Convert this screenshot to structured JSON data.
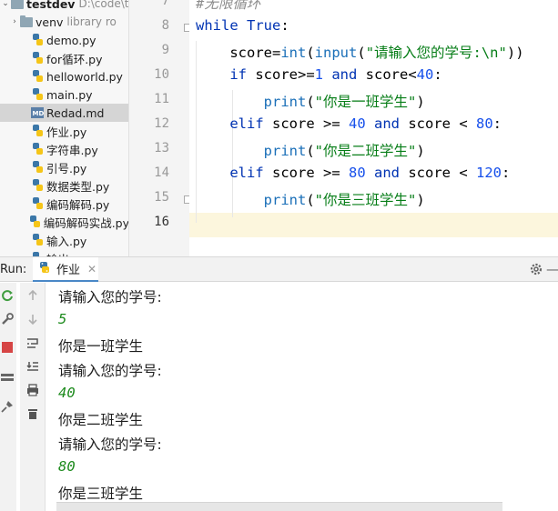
{
  "project": {
    "root": {
      "name": "testdev",
      "path": "D:\\code\\t"
    },
    "items": [
      {
        "type": "folder",
        "name": "venv",
        "note": "library ro"
      },
      {
        "type": "py",
        "name": "demo.py"
      },
      {
        "type": "py",
        "name": "for循环.py"
      },
      {
        "type": "py",
        "name": "helloworld.py"
      },
      {
        "type": "py",
        "name": "main.py"
      },
      {
        "type": "md",
        "name": "Redad.md",
        "selected": true
      },
      {
        "type": "py",
        "name": "作业.py"
      },
      {
        "type": "py",
        "name": "字符串.py"
      },
      {
        "type": "py",
        "name": "引号.py"
      },
      {
        "type": "py",
        "name": "数据类型.py"
      },
      {
        "type": "py",
        "name": "编码解码.py"
      },
      {
        "type": "py",
        "name": "编码解码实战.py"
      },
      {
        "type": "py",
        "name": "输入.py"
      },
      {
        "type": "py",
        "name": "输出"
      }
    ]
  },
  "editor": {
    "line_numbers": [
      "7",
      "8",
      "9",
      "10",
      "11",
      "12",
      "13",
      "14",
      "15",
      "16"
    ],
    "current_line": "16",
    "lines": [
      [
        {
          "t": "#无限循环",
          "c": "cm"
        }
      ],
      [
        {
          "t": "while ",
          "c": "kw"
        },
        {
          "t": "True",
          "c": "kw"
        },
        {
          "t": ":",
          "c": ""
        }
      ],
      [
        {
          "t": "    score=",
          "c": ""
        },
        {
          "t": "int",
          "c": "fn"
        },
        {
          "t": "(",
          "c": ""
        },
        {
          "t": "input",
          "c": "fn"
        },
        {
          "t": "(",
          "c": ""
        },
        {
          "t": "\"请输入您的学号:\\n\"",
          "c": "str"
        },
        {
          "t": "))",
          "c": ""
        }
      ],
      [
        {
          "t": "    ",
          "c": ""
        },
        {
          "t": "if ",
          "c": "kw"
        },
        {
          "t": "score>=",
          "c": ""
        },
        {
          "t": "1",
          "c": "num"
        },
        {
          "t": " and ",
          "c": "kw"
        },
        {
          "t": "score<",
          "c": ""
        },
        {
          "t": "40",
          "c": "num"
        },
        {
          "t": ":",
          "c": ""
        }
      ],
      [
        {
          "t": "        ",
          "c": ""
        },
        {
          "t": "print",
          "c": "fn"
        },
        {
          "t": "(",
          "c": ""
        },
        {
          "t": "\"你是一班学生\"",
          "c": "str"
        },
        {
          "t": ")",
          "c": ""
        }
      ],
      [
        {
          "t": "    ",
          "c": ""
        },
        {
          "t": "elif ",
          "c": "kw"
        },
        {
          "t": "score ",
          "c": ""
        },
        {
          "t": ">=",
          "c": ""
        },
        {
          "t": " 40 ",
          "c": "num"
        },
        {
          "t": "and ",
          "c": "kw"
        },
        {
          "t": "score < ",
          "c": ""
        },
        {
          "t": "80",
          "c": "num"
        },
        {
          "t": ":",
          "c": ""
        }
      ],
      [
        {
          "t": "        ",
          "c": ""
        },
        {
          "t": "print",
          "c": "fn"
        },
        {
          "t": "(",
          "c": ""
        },
        {
          "t": "\"你是二班学生\"",
          "c": "str"
        },
        {
          "t": ")",
          "c": ""
        }
      ],
      [
        {
          "t": "    ",
          "c": ""
        },
        {
          "t": "elif ",
          "c": "kw"
        },
        {
          "t": "score ",
          "c": ""
        },
        {
          "t": ">=",
          "c": ""
        },
        {
          "t": " 80 ",
          "c": "num"
        },
        {
          "t": "and ",
          "c": "kw"
        },
        {
          "t": "score < ",
          "c": ""
        },
        {
          "t": "120",
          "c": "num"
        },
        {
          "t": ":",
          "c": ""
        }
      ],
      [
        {
          "t": "        ",
          "c": ""
        },
        {
          "t": "print",
          "c": "fn"
        },
        {
          "t": "(",
          "c": ""
        },
        {
          "t": "\"你是三班学生\"",
          "c": "str"
        },
        {
          "t": ")",
          "c": ""
        }
      ],
      []
    ]
  },
  "run": {
    "label": "Run:",
    "tab_label": "作业",
    "close_glyph": "✕",
    "console": [
      {
        "text": "请输入您的学号:",
        "kind": "output"
      },
      {
        "text": "5",
        "kind": "input"
      },
      {
        "text": "你是一班学生",
        "kind": "output"
      },
      {
        "text": "请输入您的学号:",
        "kind": "output"
      },
      {
        "text": "40",
        "kind": "input"
      },
      {
        "text": "你是二班学生",
        "kind": "output"
      },
      {
        "text": "请输入您的学号:",
        "kind": "output"
      },
      {
        "text": "80",
        "kind": "input"
      },
      {
        "text": "你是三班学生",
        "kind": "output"
      }
    ]
  },
  "colors": {
    "keyword": "#0033b3",
    "function": "#1a6fb8",
    "string": "#067d17",
    "number": "#1750eb",
    "comment": "#8c8c8c",
    "console_input": "#1d8b1d",
    "current_line_bg": "#fcf6dd",
    "tab_underline": "#4a88c7"
  },
  "icons": {
    "rerun": "rerun-icon",
    "stop": "stop-icon",
    "settings": "gear-icon",
    "hide": "minimize-icon",
    "python": "python-icon"
  }
}
